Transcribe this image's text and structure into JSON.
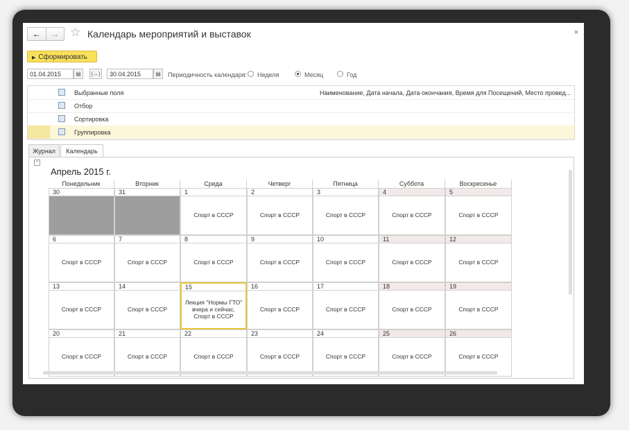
{
  "window": {
    "title": "Календарь мероприятий и выставок",
    "close": "×",
    "back": "←",
    "forward": "→",
    "star": "☆"
  },
  "toolbar": {
    "generate_label": "Сформировать",
    "generate_arrow": "▶"
  },
  "period": {
    "start": "01.04.2015",
    "end": "30.04.2015",
    "cal_btn": "▤",
    "link_btn": "(↔)",
    "label": "Периодичность календаря:",
    "options": [
      "Неделя",
      "Месяц",
      "Год"
    ],
    "selected": "Месяц"
  },
  "settings": [
    {
      "name": "Выбранные поля",
      "value": "Наименование, Дата начала, Дата окончания, Время для Посещений, Место провед..."
    },
    {
      "name": "Отбор",
      "value": ""
    },
    {
      "name": "Сортировка",
      "value": ""
    },
    {
      "name": "Группировка",
      "value": ""
    }
  ],
  "tabs": [
    "Журнал",
    "Календарь"
  ],
  "active_tab": "Календарь",
  "calendar": {
    "month_title": "Апрель 2015 г.",
    "collapse": "−",
    "days": [
      "Понедельник",
      "Вторник",
      "Среда",
      "Четверг",
      "Пятница",
      "Суббота",
      "Воскресенье"
    ],
    "weeks": [
      [
        {
          "n": "30",
          "e": "",
          "gray": true
        },
        {
          "n": "31",
          "e": "",
          "gray": true
        },
        {
          "n": "1",
          "e": "Спорт в СССР"
        },
        {
          "n": "2",
          "e": "Спорт в СССР"
        },
        {
          "n": "3",
          "e": "Спорт в СССР"
        },
        {
          "n": "4",
          "e": "Спорт в СССР"
        },
        {
          "n": "5",
          "e": "Спорт в СССР"
        }
      ],
      [
        {
          "n": "6",
          "e": "Спорт в СССР"
        },
        {
          "n": "7",
          "e": "Спорт в СССР"
        },
        {
          "n": "8",
          "e": "Спорт в СССР"
        },
        {
          "n": "9",
          "e": "Спорт в СССР"
        },
        {
          "n": "10",
          "e": "Спорт в СССР"
        },
        {
          "n": "11",
          "e": "Спорт в СССР"
        },
        {
          "n": "12",
          "e": "Спорт в СССР"
        }
      ],
      [
        {
          "n": "13",
          "e": "Спорт в СССР"
        },
        {
          "n": "14",
          "e": "Спорт в СССР"
        },
        {
          "n": "15",
          "e": "Лекция \"Нормы ГТО\" вчера и сейчас, Спорт в СССР",
          "hl": true
        },
        {
          "n": "16",
          "e": "Спорт в СССР"
        },
        {
          "n": "17",
          "e": "Спорт в СССР"
        },
        {
          "n": "18",
          "e": "Спорт в СССР"
        },
        {
          "n": "19",
          "e": "Спорт в СССР"
        }
      ],
      [
        {
          "n": "20",
          "e": "Спорт в СССР"
        },
        {
          "n": "21",
          "e": "Спорт в СССР"
        },
        {
          "n": "22",
          "e": "Спорт в СССР"
        },
        {
          "n": "23",
          "e": "Спорт в СССР"
        },
        {
          "n": "24",
          "e": "Спорт в СССР"
        },
        {
          "n": "25",
          "e": "Спорт в СССР"
        },
        {
          "n": "26",
          "e": "Спорт в СССР"
        }
      ]
    ]
  }
}
